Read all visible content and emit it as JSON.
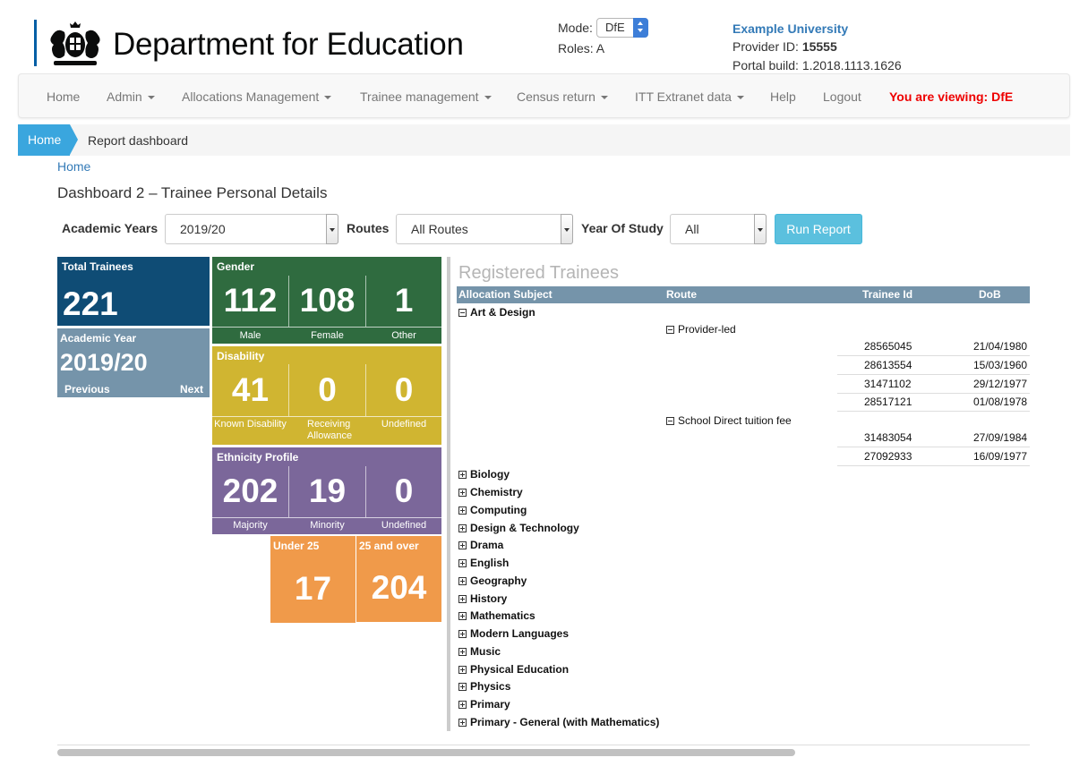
{
  "header": {
    "dept_title": "Department for Education",
    "mode_label": "Mode:",
    "mode_value": "DfE",
    "roles": "Roles: A",
    "org_name": "Example University",
    "provider_id_label": "Provider ID: ",
    "provider_id": "15555",
    "portal_build": "Portal build: 1.2018.1113.1626"
  },
  "nav": {
    "items": [
      "Home",
      "Admin",
      "Allocations Management",
      "Trainee management",
      "Census return",
      "ITT Extranet data",
      "Help",
      "Logout"
    ],
    "viewing": "You are viewing: DfE"
  },
  "breadcrumb": {
    "home": "Home",
    "current": "Report dashboard"
  },
  "page": {
    "home_link": "Home",
    "title": "Dashboard 2 – Trainee Personal Details"
  },
  "filters": {
    "academic_years_label": "Academic Years",
    "academic_years_value": "2019/20",
    "routes_label": "Routes",
    "routes_value": "All Routes",
    "year_of_study_label": "Year Of Study",
    "year_of_study_value": "All",
    "run_report": "Run Report"
  },
  "tiles": {
    "total": {
      "title": "Total Trainees",
      "value": "221"
    },
    "academic_year": {
      "title": "Academic Year",
      "value": "2019/20",
      "previous": "Previous",
      "next": "Next"
    },
    "gender": {
      "title": "Gender",
      "values": [
        "112",
        "108",
        "1"
      ],
      "labels": [
        "Male",
        "Female",
        "Other"
      ]
    },
    "disability": {
      "title": "Disability",
      "values": [
        "41",
        "0",
        "0"
      ],
      "labels": [
        "Known Disability",
        "Receiving Allowance",
        "Undefined"
      ]
    },
    "ethnicity": {
      "title": "Ethnicity Profile",
      "values": [
        "202",
        "19",
        "0"
      ],
      "labels": [
        "Majority",
        "Minority",
        "Undefined"
      ]
    },
    "under25": {
      "title": "Under 25",
      "value": "17"
    },
    "over25": {
      "title": "25 and over",
      "value": "204"
    }
  },
  "table": {
    "title": "Registered Trainees",
    "columns": [
      "Allocation Subject",
      "Route",
      "Trainee Id",
      "DoB"
    ],
    "expanded_subject": "Art & Design",
    "routes": [
      {
        "name": "Provider-led",
        "rows": [
          [
            "28565045",
            "21/04/1980"
          ],
          [
            "28613554",
            "15/03/1960"
          ],
          [
            "31471102",
            "29/12/1977"
          ],
          [
            "28517121",
            "01/08/1978"
          ]
        ]
      },
      {
        "name": "School Direct tuition fee",
        "rows": [
          [
            "31483054",
            "27/09/1984"
          ],
          [
            "27092933",
            "16/09/1977"
          ]
        ]
      }
    ],
    "collapsed_subjects": [
      "Biology",
      "Chemistry",
      "Computing",
      "Design & Technology",
      "Drama",
      "English",
      "Geography",
      "History",
      "Mathematics",
      "Modern Languages",
      "Music",
      "Physical Education",
      "Physics",
      "Primary",
      "Primary - General (with Mathematics)"
    ]
  },
  "colors": {
    "total": "#0f4c75",
    "academic_year": "#7594aa",
    "gender": "#2f6b3f",
    "disability": "#d0b531",
    "ethnicity": "#7b679a",
    "age": "#f09a4a",
    "nav_alert": "#ee0000",
    "link": "#337ab7"
  }
}
